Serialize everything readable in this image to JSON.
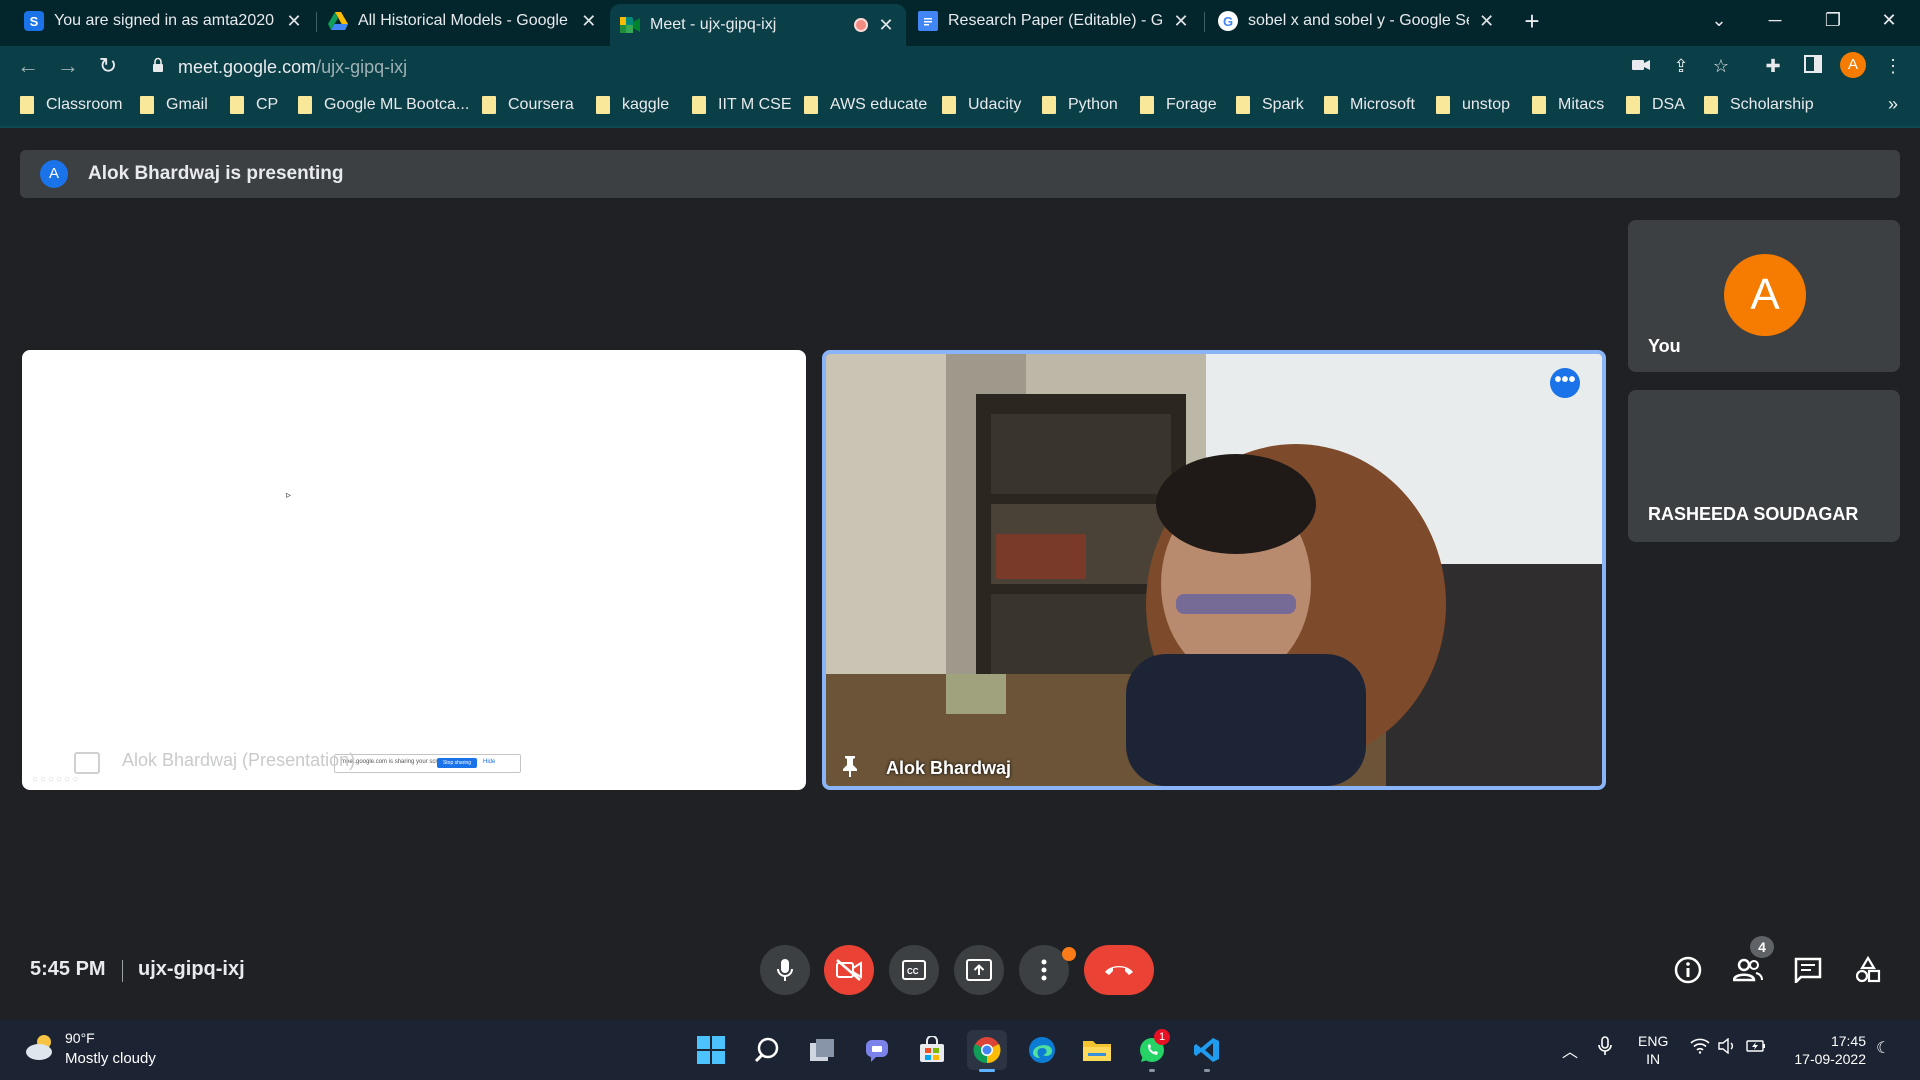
{
  "browser": {
    "tabs": [
      {
        "title": "You are signed in as amta2020",
        "favicon_letter": "S",
        "favicon_color": "#1a73e8",
        "active": false
      },
      {
        "title": "All Historical Models - Google Dr",
        "favicon_letter": "",
        "favicon_color": "#fbbc04",
        "active": false
      },
      {
        "title": "Meet - ujx-gipq-ixj",
        "favicon_letter": "",
        "favicon_color": "#00897b",
        "active": true
      },
      {
        "title": "Research Paper (Editable) - Goog",
        "favicon_letter": "",
        "favicon_color": "#4285f4",
        "active": false
      },
      {
        "title": "sobel x and sobel y - Google Sea",
        "favicon_letter": "G",
        "favicon_color": "#ffffff",
        "active": false
      }
    ],
    "address": {
      "host": "meet.google.com",
      "path": "/ujx-gipq-ixj"
    },
    "profile_letter": "A",
    "bookmarks": [
      "Classroom",
      "Gmail",
      "CP",
      "Google ML Bootca...",
      "Coursera",
      "kaggle",
      "IIT M CSE",
      "AWS educate",
      "Udacity",
      "Python",
      "Forage",
      "Spark",
      "Microsoft",
      "unstop",
      "Mitacs",
      "DSA",
      "Scholarship"
    ],
    "more_bookmarks": "»"
  },
  "meet": {
    "presenting_avatar": "A",
    "presenting_text": "Alok Bhardwaj is presenting",
    "presentation_tile_label": "Alok Bhardwaj (Presentation)",
    "mini_bar_text": "meet.google.com is sharing your screen.",
    "mini_bar_stop": "Stop sharing",
    "mini_bar_hide": "Hide",
    "camera_tile_name": "Alok Bhardwaj",
    "you_avatar": "A",
    "you_label": "You",
    "other_participant": "RASHEEDA SOUDAGAR",
    "time": "5:45 PM",
    "meeting_code": "ujx-gipq-ixj",
    "participant_count": "4"
  },
  "taskbar": {
    "temperature": "90°F",
    "condition": "Mostly cloudy",
    "whatsapp_badge": "1",
    "lang_primary": "ENG",
    "lang_secondary": "IN",
    "clock_time": "17:45",
    "clock_date": "17-09-2022"
  }
}
